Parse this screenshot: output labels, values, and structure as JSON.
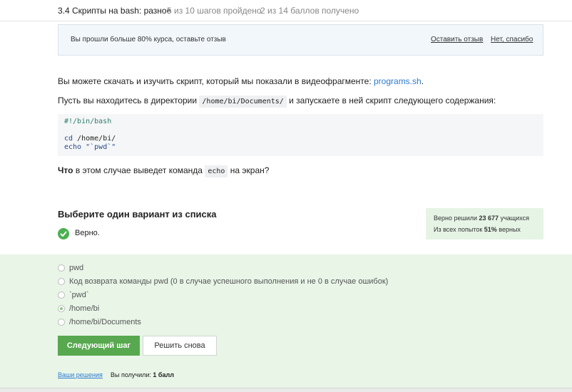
{
  "header": {
    "title": "3.4 Скрипты на bash: разное",
    "steps": "5 из 10 шагов пройдено",
    "points": "2 из 14 баллов  получено"
  },
  "review_banner": {
    "message": "Вы прошли больше 80% курса, оставьте отзыв",
    "leave_review": "Оставить отзыв",
    "no_thanks": "Нет, спасибо"
  },
  "content": {
    "p1_text": "Вы можете скачать и изучить скрипт, который мы показали в видеофрагменте: ",
    "p1_link": "programs.sh",
    "p1_end": ".",
    "p2_before": "Пусть вы находитесь в директории ",
    "p2_code": "/home/bi/Documents/",
    "p2_after": " и запускаете в ней скрипт следующего содержания:",
    "code": {
      "line1": "#!/bin/bash",
      "line3_cmd": "cd",
      "line3_arg": " /home/bi/",
      "line4_cmd": "echo",
      "line4_arg": " \"`pwd`\""
    },
    "q_bold": "Что",
    "q_mid": " в этом случае выведет команда ",
    "q_code": "echo",
    "q_end": " на экран?"
  },
  "quiz": {
    "title": "Выберите один вариант из списка",
    "verdict": "Верно.",
    "stats": {
      "solved_prefix": "Верно решили ",
      "solved_count": "23 677",
      "solved_suffix": " учащихся",
      "attempts_prefix": "Из всех попыток ",
      "attempts_percent": "51%",
      "attempts_suffix": " верных"
    },
    "options": [
      {
        "label": "pwd",
        "selected": false
      },
      {
        "label": "Код возврата команды pwd (0 в случае успешного выполнения и не 0 в случае ошибок)",
        "selected": false
      },
      {
        "label": "`pwd`",
        "selected": false
      },
      {
        "label": "/home/bi",
        "selected": true
      },
      {
        "label": "/home/bi/Documents",
        "selected": false
      }
    ],
    "next_button": "Следующий шаг",
    "retry_button": "Решить снова",
    "your_solutions": "Ваши решения",
    "score_prefix": "Вы получили: ",
    "score_value": "1 балл"
  },
  "colors": {
    "accent_green": "#57a84e",
    "link_blue": "#2f7bd0",
    "answer_bg": "#e8f5e7"
  }
}
